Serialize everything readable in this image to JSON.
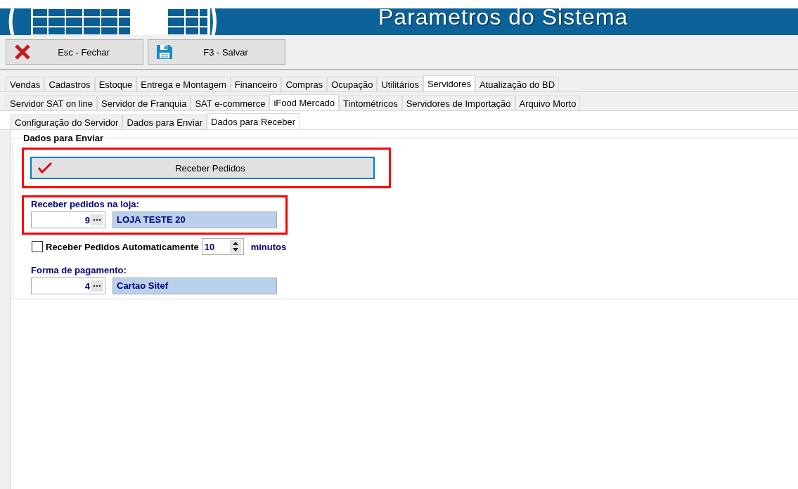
{
  "header": {
    "title": "Parametros do Sistema"
  },
  "toolbar": [
    {
      "label": "Esc - Fechar",
      "kind": "close"
    },
    {
      "label": "F3 - Salvar",
      "kind": "save"
    }
  ],
  "main_tabs": [
    {
      "label": "Vendas",
      "selected": false
    },
    {
      "label": "Cadastros",
      "selected": false
    },
    {
      "label": "Estoque",
      "selected": false
    },
    {
      "label": "Entrega e Montagem",
      "selected": false
    },
    {
      "label": "Financeiro",
      "selected": false
    },
    {
      "label": "Compras",
      "selected": false
    },
    {
      "label": "Ocupação",
      "selected": false
    },
    {
      "label": "Utilitários",
      "selected": false
    },
    {
      "label": "Servidores",
      "selected": true
    },
    {
      "label": "Atualização do BD",
      "selected": false
    }
  ],
  "server_tabs": [
    {
      "label": "Servidor SAT on line",
      "selected": false
    },
    {
      "label": "Servidor de Franquia",
      "selected": false
    },
    {
      "label": "SAT e-commerce",
      "selected": false
    },
    {
      "label": "iFood Mercado",
      "selected": true
    },
    {
      "label": "Tintométricos",
      "selected": false
    },
    {
      "label": "Servidores de Importação",
      "selected": false
    },
    {
      "label": "Arquivo Morto",
      "selected": false
    }
  ],
  "sub_tabs": [
    {
      "label": "Configuração do Servidor",
      "selected": false
    },
    {
      "label": "Dados para Enviar",
      "selected": false
    },
    {
      "label": "Dados para Receber",
      "selected": true
    }
  ],
  "group": {
    "title": "Dados para Enviar",
    "receive_button": {
      "label": "Receber Pedidos"
    },
    "store": {
      "label": "Receber pedidos na loja:",
      "code": "9",
      "name": "LOJA TESTE 20"
    },
    "auto_receive": {
      "label": "Receber Pedidos Automaticamente",
      "checked": false,
      "interval": "10",
      "unit": "minutos"
    },
    "payment": {
      "label": "Forma de pagamento:",
      "code": "4",
      "name": "Cartao Sitef"
    }
  }
}
